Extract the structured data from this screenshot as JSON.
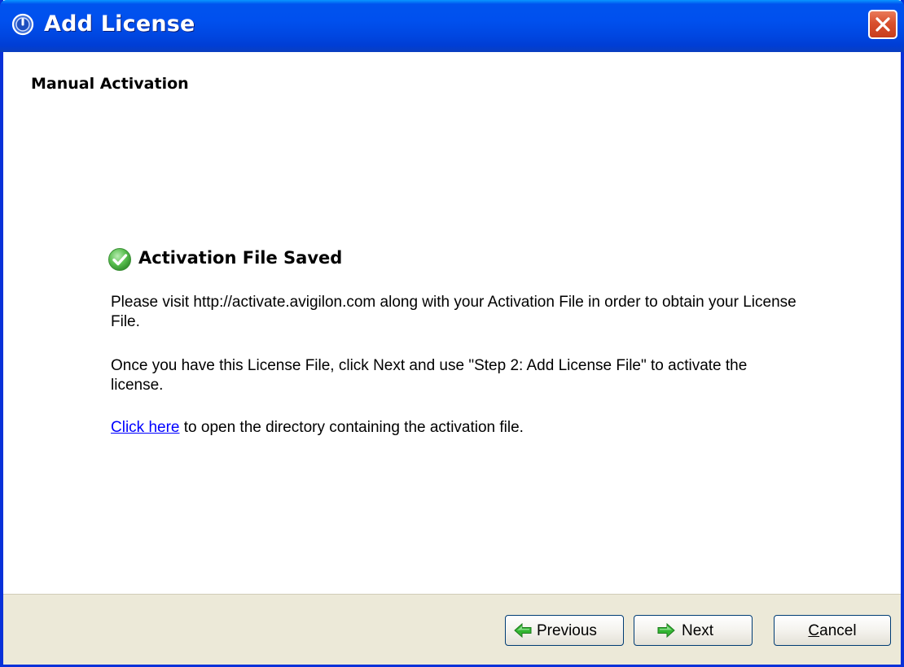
{
  "window": {
    "title": "Add License",
    "title_icon": "info-circle-icon",
    "close_icon": "close-icon"
  },
  "page": {
    "section_title": "Manual Activation",
    "status": {
      "icon": "check-circle-icon",
      "title": "Activation File Saved"
    },
    "paragraph1": "Please visit http://activate.avigilon.com along with your Activation File in order to obtain your License File.",
    "paragraph2": "Once you have this License File, click Next and use \"Step 2: Add License File\" to activate the license.",
    "link_text": "Click here",
    "link_suffix": " to open the directory containing the activation file."
  },
  "footer": {
    "previous_label": "Previous",
    "previous_icon": "arrow-left-icon",
    "next_label": "Next",
    "next_icon": "arrow-right-icon",
    "cancel_label": "Cancel"
  },
  "colors": {
    "titlebar": "#0054e3",
    "frame": "#0831d9",
    "close_button": "#d8502e",
    "footer_bg": "#ece9d8",
    "link": "#0000ff",
    "check_green": "#4caf50",
    "arrow_green": "#2fb52f"
  }
}
